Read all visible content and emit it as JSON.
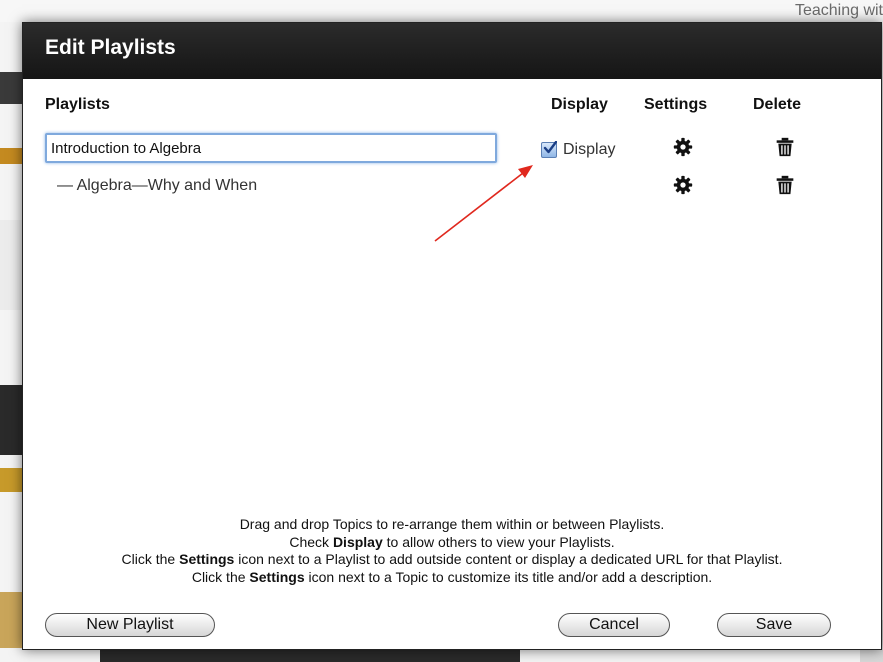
{
  "background": {
    "corner_text": "Teaching wit"
  },
  "dialog": {
    "title": "Edit Playlists",
    "columns": {
      "playlists": "Playlists",
      "display": "Display",
      "settings": "Settings",
      "delete": "Delete"
    },
    "playlist": {
      "name_value": "Introduction to Algebra",
      "display_label": "Display",
      "display_checked": true
    },
    "topics": [
      {
        "label": "— Algebra—Why and When"
      }
    ],
    "instructions": {
      "line1": "Drag and drop Topics to re-arrange them within or between Playlists.",
      "line2_pre": "Check ",
      "line2_bold": "Display",
      "line2_post": " to allow others to view your Playlists.",
      "line3_pre": "Click the ",
      "line3_bold": "Settings",
      "line3_post": " icon next to a Playlist to add outside content or display a dedicated URL for that Playlist.",
      "line4_pre": "Click the ",
      "line4_bold": "Settings",
      "line4_post": " icon next to a Topic to customize its title and/or add a description."
    },
    "buttons": {
      "new_playlist": "New Playlist",
      "cancel": "Cancel",
      "save": "Save"
    }
  },
  "icons": {
    "settings": "gear-icon",
    "delete": "trash-icon",
    "checkbox": "checkmark-icon",
    "annotation": "red-arrow"
  },
  "colors": {
    "header_bg": "#1e1e1e",
    "input_focus_border": "#7fa9dd",
    "annotation_arrow": "#e0281e"
  }
}
